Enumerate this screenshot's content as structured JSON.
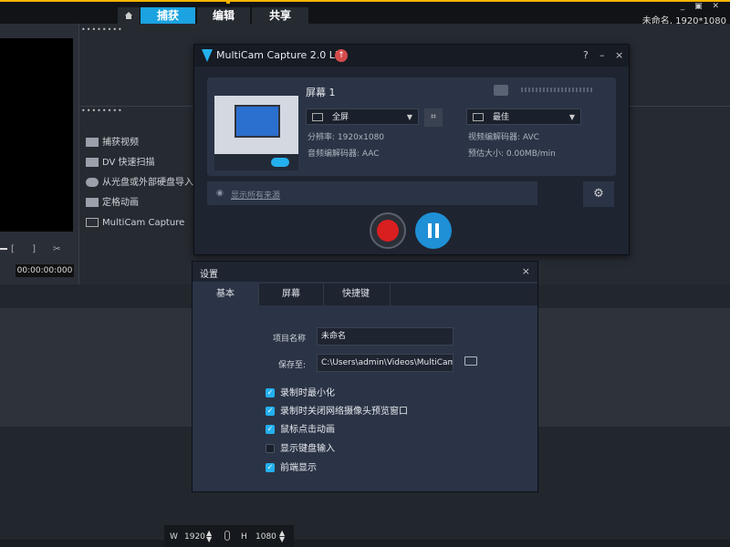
{
  "topbar": {
    "tabs": [
      "捕获",
      "编辑",
      "共享"
    ],
    "project_info": "未命名, 1920*1080",
    "window_controls": "_ ▣ ✕"
  },
  "capture_menu": {
    "items": [
      "捕获视频",
      "DV 快速扫描",
      "从光盘或外部硬盘导入",
      "定格动画",
      "MultiCam Capture"
    ]
  },
  "preview": {
    "timecode": "00:00:00:000",
    "controls": "[ ] ✂ ⧉"
  },
  "multicam": {
    "title": "MultiCam Capture 2.0 Lite",
    "help": "?",
    "minimize": "–",
    "close": "×",
    "screen_title": "屏幕 1",
    "area_select": "全屏",
    "quality_select": "最佳",
    "resolution": "分辨率: 1920x1080",
    "audio_codec": "音频编解码器: AAC",
    "video_codec": "视频编解码器: AVC",
    "est_size": "预估大小: 0.00MB/min",
    "show_all_sources": "显示所有来源"
  },
  "settings": {
    "title": "设置",
    "close": "×",
    "tabs": [
      "基本",
      "屏幕",
      "快捷键"
    ],
    "project_name_label": "项目名称",
    "project_name_value": "未命名",
    "save_to_label": "保存至:",
    "save_to_value": "C:\\Users\\admin\\Videos\\MultiCam...",
    "checkboxes": [
      {
        "label": "录制时最小化",
        "checked": true
      },
      {
        "label": "录制时关闭网络摄像头预览窗口",
        "checked": true
      },
      {
        "label": "鼠标点击动画",
        "checked": true
      },
      {
        "label": "显示键盘输入",
        "checked": false
      },
      {
        "label": "前端显示",
        "checked": true
      }
    ]
  },
  "size_bar": {
    "w_label": "W",
    "w_value": "1920",
    "h_label": "H",
    "h_value": "1080"
  },
  "colors": {
    "accent": "#24b0ef",
    "record": "#d91f1f",
    "highlight": "#f5b400"
  }
}
